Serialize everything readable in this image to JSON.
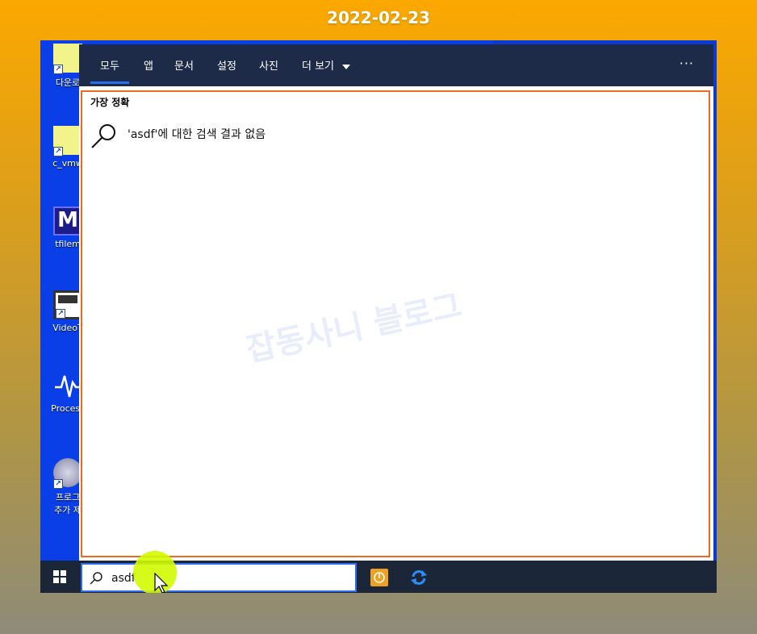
{
  "date": "2022-02-23",
  "desktop": {
    "icons": [
      {
        "label": "다운로",
        "name": "download-shortcut",
        "icon": "yellow-folder-icon"
      },
      {
        "label": "c_vmw",
        "name": "vmware-shortcut",
        "icon": "yellow-folder-icon"
      },
      {
        "label": "tfilem",
        "name": "tfilem-shortcut",
        "icon": "m-app-icon",
        "glyph": "M"
      },
      {
        "label": "VideoT",
        "name": "videot-shortcut",
        "icon": "video-window-icon"
      },
      {
        "label": "Process",
        "name": "process-shortcut",
        "icon": "pulse-icon",
        "glyph": "~"
      },
      {
        "label": "프로그",
        "label2": "추가 제",
        "name": "programs-shortcut",
        "icon": "disc-icon"
      }
    ]
  },
  "search_panel": {
    "tabs": [
      {
        "label": "모두",
        "active": true
      },
      {
        "label": "앱"
      },
      {
        "label": "문서"
      },
      {
        "label": "설정"
      },
      {
        "label": "사진"
      },
      {
        "label": "더 보기"
      }
    ],
    "more_menu": "···",
    "section_title": "가장 정확",
    "no_result_text": "'asdf'에 대한 검색 결과 없음",
    "watermark": "잡동사니 블로그"
  },
  "taskbar": {
    "search_value": "asdf",
    "icons": [
      "windows-start-icon",
      "search-icon",
      "power-app-icon",
      "refresh-app-icon"
    ]
  },
  "colors": {
    "accent": "#2e6cf0",
    "highlight_border": "#ee6a20",
    "panel_header": "#1e2b48",
    "taskbar": "#1b2638",
    "desktop": "#0a3fe8"
  }
}
